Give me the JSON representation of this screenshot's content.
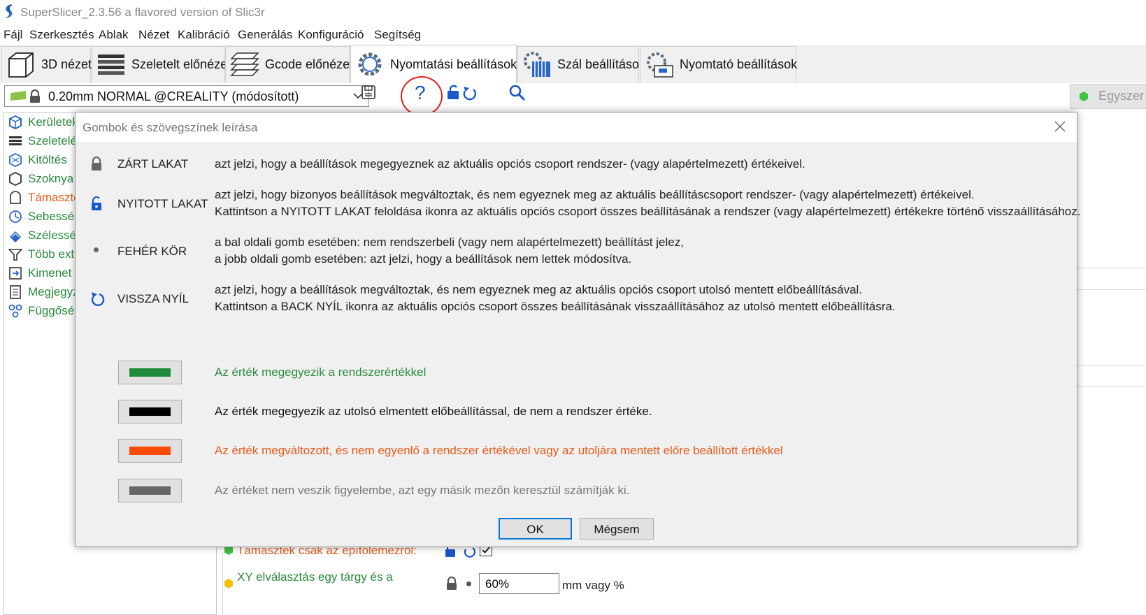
{
  "window": {
    "title": "SuperSlicer_2.3.56 a flavored version of Slic3r"
  },
  "menu": [
    "Fájl",
    "Szerkesztés",
    "Ablak",
    "Nézet",
    "Kalibráció",
    "Generálás",
    "Konfiguráció",
    "Segítség"
  ],
  "tabs": [
    {
      "label": "3D nézet",
      "icon": "cube-icon"
    },
    {
      "label": "Szeletelt előnézet",
      "icon": "layers-icon"
    },
    {
      "label": "Gcode előnézet",
      "icon": "gcode-layers-icon"
    },
    {
      "label": "Nyomtatási beállítások",
      "icon": "gear-icon",
      "active": true
    },
    {
      "label": "Szál beállítások",
      "icon": "filament-gear-icon"
    },
    {
      "label": "Nyomtató beállítások",
      "icon": "printer-gear-icon"
    }
  ],
  "toolbar": {
    "preset_value": "0.20mm NORMAL @CREALITY (módosított)",
    "help_glyph": "?",
    "mode_label": "Egyszer"
  },
  "sidebar": {
    "items": [
      {
        "label": "Kerületek",
        "icon": "perimeters-icon",
        "color": "green"
      },
      {
        "label": "Szeletelés",
        "icon": "slicing-icon",
        "color": "green"
      },
      {
        "label": "Kitöltés",
        "icon": "infill-icon",
        "color": "green"
      },
      {
        "label": "Szoknya",
        "icon": "skirt-icon",
        "color": "green"
      },
      {
        "label": "Támaszté",
        "icon": "support-icon",
        "color": "orange"
      },
      {
        "label": "Sebesség",
        "icon": "speed-icon",
        "color": "green"
      },
      {
        "label": "Szélesség",
        "icon": "width-icon",
        "color": "green"
      },
      {
        "label": "Több ext",
        "icon": "multi-extruder-icon",
        "color": "green"
      },
      {
        "label": "Kimenet l",
        "icon": "output-icon",
        "color": "green"
      },
      {
        "label": "Megjegyz",
        "icon": "notes-icon",
        "color": "green"
      },
      {
        "label": "Függősé",
        "icon": "dependencies-icon",
        "color": "green"
      }
    ]
  },
  "background_rows": {
    "support_build_plate": "Támaszték csak az építőlemezről:",
    "xy_separation": "XY elválasztás egy tárgy és a",
    "xy_value": "60%",
    "xy_unit": "mm vagy %"
  },
  "dialog": {
    "title": "Gombok és szövegszínek leírása",
    "legend": [
      {
        "icon": "locked-lock-icon",
        "name": "ZÁRT LAKAT",
        "lines": [
          "azt jelzi, hogy a beállítások megegyeznek az aktuális opciós csoport rendszer- (vagy alapértelmezett) értékeivel."
        ]
      },
      {
        "icon": "unlocked-lock-icon",
        "name": "NYITOTT LAKAT",
        "lines": [
          "azt jelzi, hogy bizonyos beállítások megváltoztak, és nem egyeznek meg az aktuális beállításcsoport rendszer- (vagy alapértelmezett) értékeivel.",
          "Kattintson a NYITOTT LAKAT feloldása ikonra az aktuális opciós csoport összes beállításának a rendszer (vagy alapértelmezett) értékekre történő visszaállításához."
        ]
      },
      {
        "icon": "white-dot-icon",
        "name": "FEHÉR KÖR",
        "lines": [
          "a bal oldali gomb esetében: nem rendszerbeli (vagy nem alapértelmezett) beállítást jelez,",
          "a jobb oldali gomb esetében: azt jelzi, hogy a beállítások nem lettek módosítva."
        ]
      },
      {
        "icon": "back-arrow-icon",
        "name": "VISSZA NYÍL",
        "lines": [
          "azt jelzi, hogy a beállítások megváltoztak, és nem egyeznek meg az aktuális opciós csoport utolsó mentett előbeállításával.",
          "Kattintson a BACK NYÍL ikonra az aktuális opciós csoport összes beállításának visszaállításához az utolsó mentett előbeállításra."
        ]
      }
    ],
    "colors": [
      {
        "swatch": "#1f8a3c",
        "text_color": "#2a8a3c",
        "text": "Az érték megegyezik a rendszerértékkel"
      },
      {
        "swatch": "#000000",
        "text_color": "#111111",
        "text": "Az érték megegyezik az utolsó elmentett előbeállítással, de nem a rendszer értéke."
      },
      {
        "swatch": "#fc4c02",
        "text_color": "#e85a1a",
        "text": "Az érték megváltozott, és nem egyenlő a rendszer értékével vagy az utoljára mentett előre beállított értékkel"
      },
      {
        "swatch": "#666666",
        "text_color": "#777777",
        "text": "Az értéket nem veszik figyelembe, azt egy másik mezőn keresztül számítják ki."
      }
    ],
    "ok_label": "OK",
    "cancel_label": "Mégsem"
  }
}
